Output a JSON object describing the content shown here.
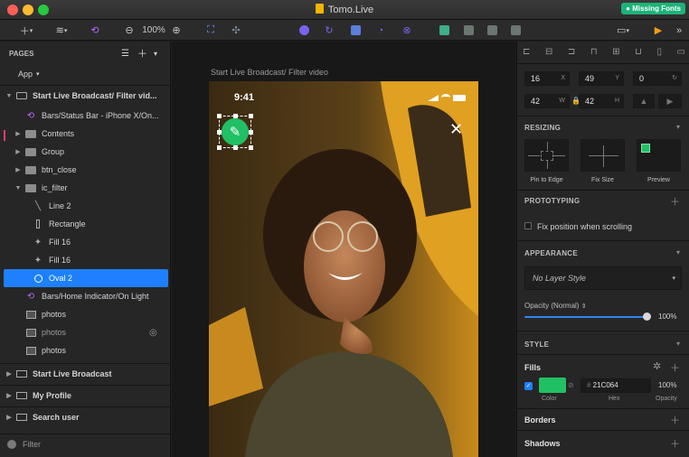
{
  "window": {
    "title": "Tomo.Live",
    "missing_fonts": "Missing Fonts"
  },
  "toolbar": {
    "zoom": "100%"
  },
  "pages": {
    "heading": "PAGES",
    "app": "App",
    "artboard_selected": "Start Live Broadcast/ Filter vid...",
    "layers": [
      {
        "label": "Bars/Status Bar - iPhone X/On...",
        "icon": "symbol-icon"
      },
      {
        "label": "Contents",
        "icon": "folder-icon"
      },
      {
        "label": "Group",
        "icon": "folder-icon"
      },
      {
        "label": "btn_close",
        "icon": "folder-icon"
      },
      {
        "label": "ic_filter",
        "icon": "folder-icon"
      },
      {
        "label": "Line 2",
        "icon": "line-icon"
      },
      {
        "label": "Rectangle",
        "icon": "rectangle-icon"
      },
      {
        "label": "Fill 16",
        "icon": "shape-icon"
      },
      {
        "label": "Fill 16",
        "icon": "shape-icon"
      },
      {
        "label": "Oval 2",
        "icon": "oval-icon"
      },
      {
        "label": "Bars/Home Indicator/On Light",
        "icon": "symbol-icon"
      },
      {
        "label": "photos",
        "icon": "image-icon"
      },
      {
        "label": "photos",
        "icon": "image-icon"
      },
      {
        "label": "photos",
        "icon": "image-icon"
      }
    ],
    "artboards": [
      "Start Live Broadcast",
      "My Profile",
      "Search user"
    ],
    "filter": "Filter"
  },
  "canvas": {
    "artboard_title": "Start Live Broadcast/ Filter video",
    "time": "9:41"
  },
  "inspector": {
    "x": "16",
    "y": "49",
    "rotation": "0",
    "w": "42",
    "h": "42",
    "labels": {
      "x": "X",
      "y": "Y",
      "w": "W",
      "h": "H"
    },
    "resizing": "RESIZING",
    "pin_to_edge": "Pin to Edge",
    "fix_size": "Fix Size",
    "preview": "Preview",
    "prototyping": "PROTOTYPING",
    "fix_position": "Fix position when scrolling",
    "appearance": "APPEARANCE",
    "layer_style": "No Layer Style",
    "opacity_label": "Opacity (Normal)",
    "opacity_value": "100%",
    "opacity_fraction": 1.0,
    "style": "STYLE",
    "fills": "Fills",
    "fill_hex": "21C064",
    "fill_opacity": "100%",
    "fill_color": "#21C064",
    "col_color": "Color",
    "col_hex": "Hex",
    "col_opacity": "Opacity",
    "borders": "Borders",
    "shadows": "Shadows"
  },
  "colors": {
    "accent": "#1E80FF",
    "missing_fonts_badge": "#1DB37A"
  }
}
